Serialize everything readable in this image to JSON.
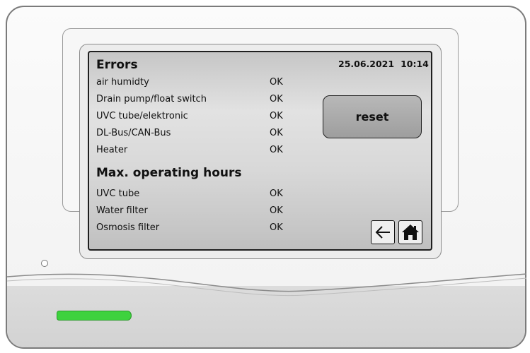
{
  "header": {
    "title": "Errors",
    "date": "25.06.2021",
    "time": "10:14"
  },
  "errors": [
    {
      "label": "air humidty",
      "status": "OK"
    },
    {
      "label": "Drain pump/float switch",
      "status": "OK"
    },
    {
      "label": "UVC tube/elektronic",
      "status": "OK"
    },
    {
      "label": "DL-Bus/CAN-Bus",
      "status": "OK"
    },
    {
      "label": "Heater",
      "status": "OK"
    }
  ],
  "operating_hours": {
    "title": "Max. operating hours",
    "items": [
      {
        "label": "UVC tube",
        "status": "OK"
      },
      {
        "label": "Water filter",
        "status": "OK"
      },
      {
        "label": "Osmosis filter",
        "status": "OK"
      }
    ]
  },
  "buttons": {
    "reset_label": "reset",
    "back_icon": "arrow-left-icon",
    "home_icon": "home-icon"
  },
  "colors": {
    "status_led": "#3ed23e"
  }
}
